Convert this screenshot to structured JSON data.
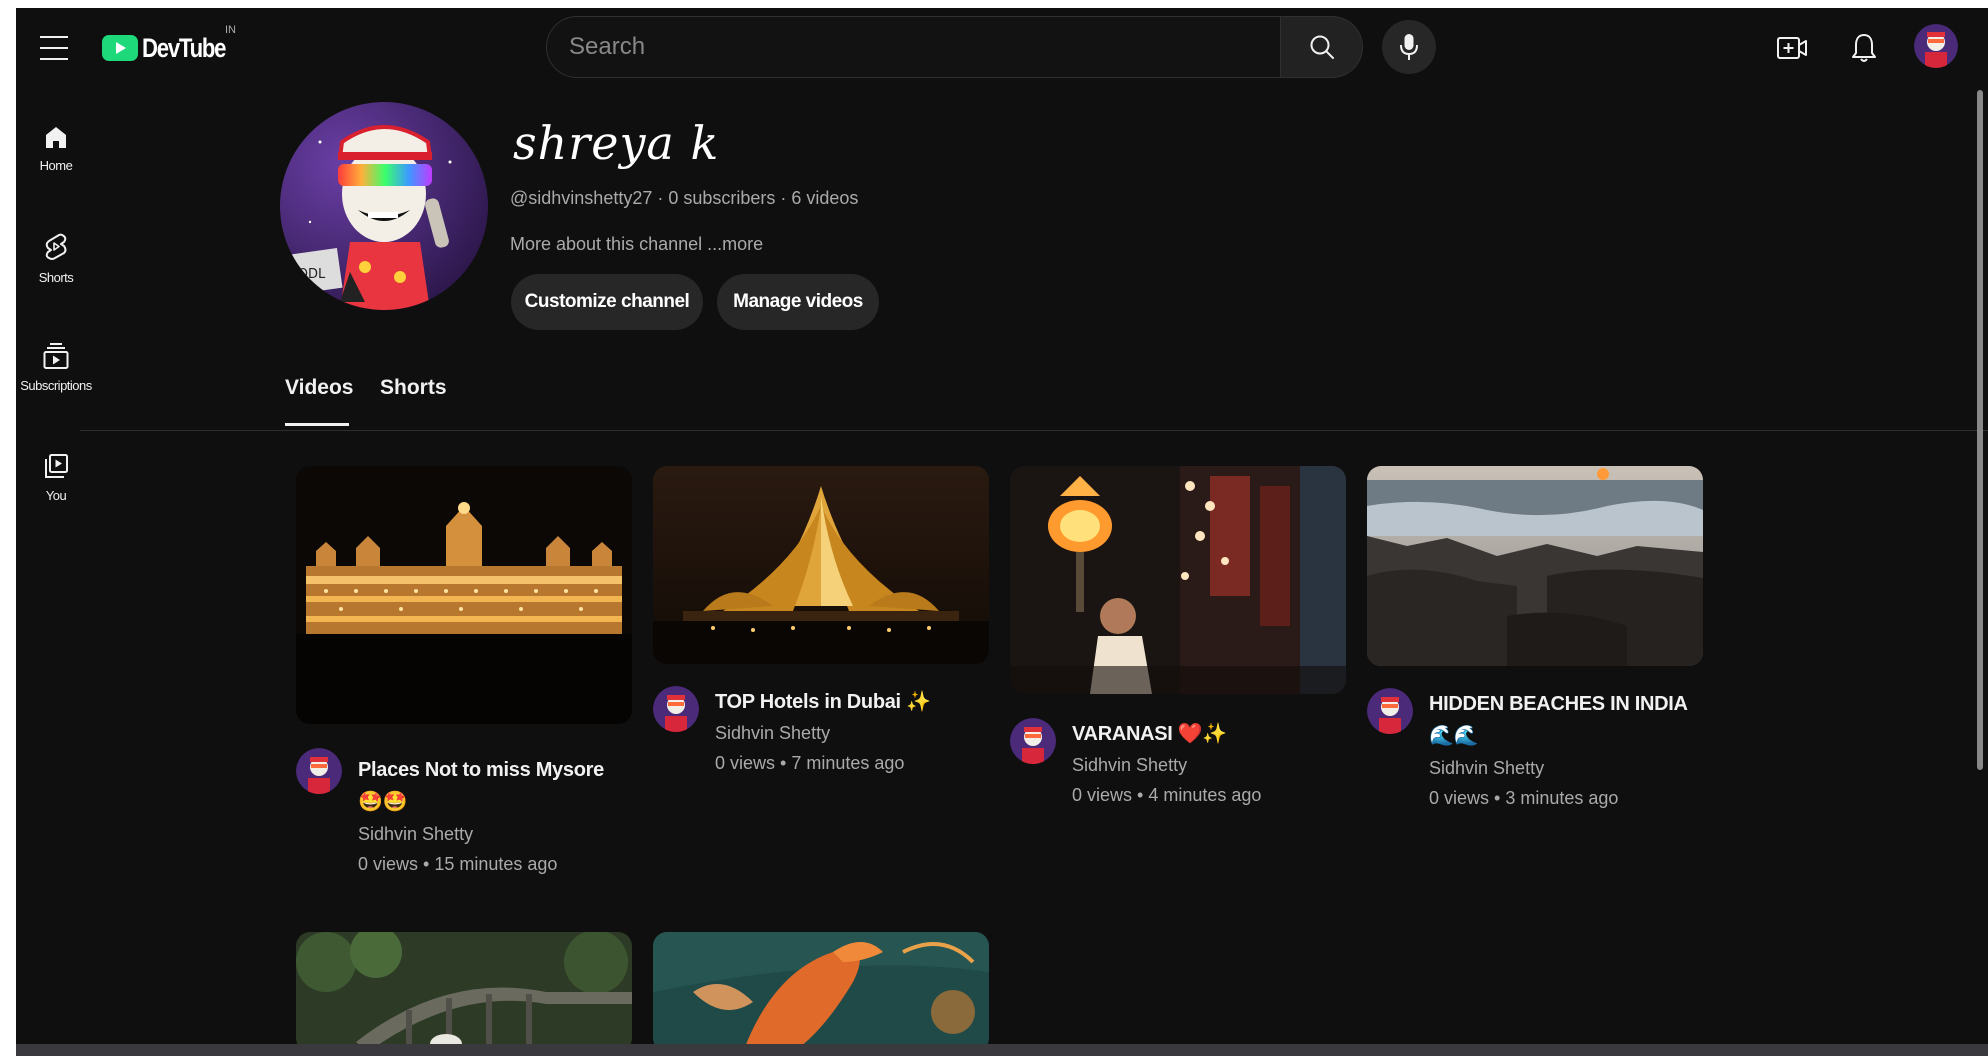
{
  "app": {
    "name": "DevTube",
    "region": "IN"
  },
  "search": {
    "placeholder": "Search"
  },
  "sidebar": {
    "items": [
      {
        "label": "Home",
        "icon": "home-icon"
      },
      {
        "label": "Shorts",
        "icon": "shorts-icon"
      },
      {
        "label": "Subscriptions",
        "icon": "subscriptions-icon"
      },
      {
        "label": "You",
        "icon": "you-icon"
      }
    ]
  },
  "channel": {
    "name": "shreya k",
    "meta": "@sidhvinshetty27 · 0 subscribers · 6 videos",
    "about": "More about this channel ...more",
    "customize_label": "Customize channel",
    "manage_label": "Manage videos"
  },
  "tabs": [
    {
      "label": "Videos",
      "active": true
    },
    {
      "label": "Shorts",
      "active": false
    }
  ],
  "videos": [
    {
      "title": "Places Not to miss Mysore 🤩🤩",
      "channel": "Sidhvin Shetty",
      "stats": "0 views • 15 minutes ago"
    },
    {
      "title": "TOP Hotels in Dubai ✨",
      "channel": "Sidhvin Shetty",
      "stats": "0 views • 7 minutes ago"
    },
    {
      "title": "VARANASI ❤️✨",
      "channel": "Sidhvin Shetty",
      "stats": "0 views • 4 minutes ago"
    },
    {
      "title": "HIDDEN BEACHES IN INDIA 🌊🌊",
      "channel": "Sidhvin Shetty",
      "stats": "0 views • 3 minutes ago"
    }
  ],
  "colors": {
    "background": "#0f0f0f",
    "logo": "#1ed97a",
    "button": "#272727",
    "secondary_text": "#aaaaaa"
  }
}
